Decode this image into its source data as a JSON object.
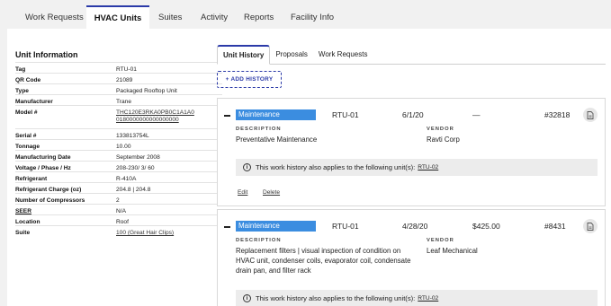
{
  "top_tabs": [
    {
      "label": "Work Requests",
      "active": false
    },
    {
      "label": "HVAC Units",
      "active": true
    },
    {
      "label": "Suites",
      "active": false
    },
    {
      "label": "Activity",
      "active": false
    },
    {
      "label": "Reports",
      "active": false
    },
    {
      "label": "Facility Info",
      "active": false
    }
  ],
  "unit_info": {
    "title": "Unit Information",
    "rows": [
      {
        "key": "Tag",
        "value": "RTU-01"
      },
      {
        "key": "QR Code",
        "value": "21089"
      },
      {
        "key": "Type",
        "value": "Packaged Rooftop Unit"
      },
      {
        "key": "Manufacturer",
        "value": "Trane"
      },
      {
        "key": "Model #",
        "value": "THC120E3RKA0PB0C1A1A0",
        "value2": "0180000000000000000"
      },
      {
        "key": "Serial #",
        "value": "133813754L"
      },
      {
        "key": "Tonnage",
        "value": "10.00"
      },
      {
        "key": "Manufacturing Date",
        "value": "September 2008"
      },
      {
        "key": "Voltage / Phase / Hz",
        "value": "208-230/ 3/ 60"
      },
      {
        "key": "Refrigerant",
        "value": "R-410A"
      },
      {
        "key": "Refrigerant Charge (oz)",
        "value": "204.8 | 204.8"
      },
      {
        "key": "Number of Compressors",
        "value": "2"
      },
      {
        "key": "SEER",
        "value": "N/A"
      },
      {
        "key": "Location",
        "value": "Roof"
      },
      {
        "key": "Suite",
        "value": "100 (Great Hair Clips)"
      }
    ]
  },
  "sub_tabs": [
    {
      "label": "Unit History",
      "active": true
    },
    {
      "label": "Proposals",
      "active": false
    },
    {
      "label": "Work Requests",
      "active": false
    }
  ],
  "add_history_label": "+ ADD HISTORY",
  "history": [
    {
      "type": "Maintenance",
      "unit": "RTU-01",
      "date": "6/1/20",
      "cost": "—",
      "number": "#32818",
      "description_label": "DESCRIPTION",
      "description": "Preventative Maintenance",
      "vendor_label": "VENDOR",
      "vendor": "Ravti Corp",
      "note": "This work history also applies to the following unit(s):",
      "note_link": "RTU-02",
      "edit_label": "Edit",
      "delete_label": "Delete"
    },
    {
      "type": "Maintenance",
      "unit": "RTU-01",
      "date": "4/28/20",
      "cost": "$425.00",
      "number": "#8431",
      "description_label": "DESCRIPTION",
      "description": "Replacement filters | visual inspection of condition on HVAC unit, condenser coils, evaporator coil, condensate drain pan, and filter rack",
      "vendor_label": "VENDOR",
      "vendor": "Leaf Mechanical",
      "note": "This work history also applies to the following unit(s):",
      "note_link": "RTU-02"
    }
  ],
  "colors": {
    "accent": "#2b3aa8",
    "type_badge": "#3b8de0"
  }
}
